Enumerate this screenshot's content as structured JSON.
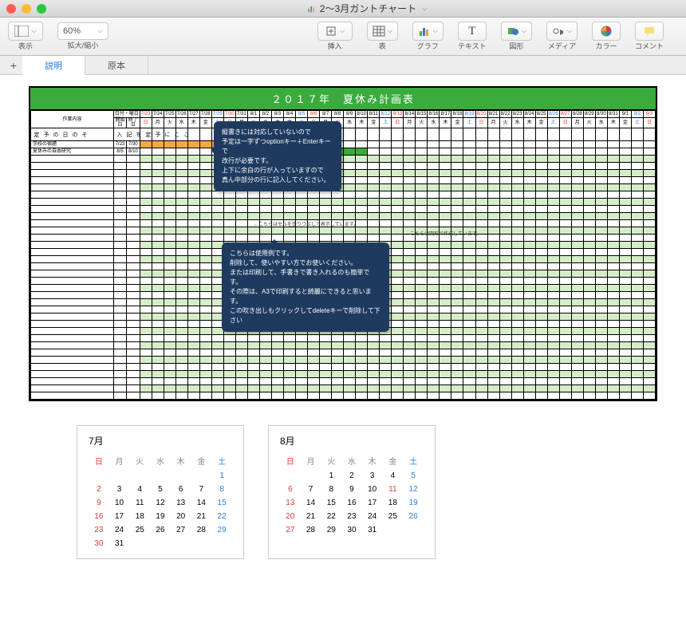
{
  "window": {
    "document_title": "2〜3月ガントチャート"
  },
  "toolbar": {
    "view_label": "表示",
    "zoom_value": "60%",
    "zoom_label": "拡大/縮小",
    "insert_label": "挿入",
    "table_label": "表",
    "chart_label": "グラフ",
    "text_label": "テキスト",
    "shape_label": "図形",
    "media_label": "メディア",
    "color_label": "カラー",
    "comment_label": "コメント"
  },
  "tabs": {
    "active": "説明",
    "other": "原本"
  },
  "sheet": {
    "title": "２０１７年　夏休み計画表",
    "header_work": "作業内容",
    "header_date": "日付・曜日",
    "header_start": "開始日",
    "header_end": "終了日",
    "schedule_label": "その日の予定",
    "schedule_hint": "ここに予定を記入",
    "dates": [
      "7/23",
      "7/24",
      "7/25",
      "7/26",
      "7/27",
      "7/28",
      "7/29",
      "7/30",
      "7/31",
      "8/1",
      "8/2",
      "8/3",
      "8/4",
      "8/5",
      "8/6",
      "8/7",
      "8/8",
      "8/9",
      "8/10",
      "8/11",
      "8/12",
      "8/13",
      "8/14",
      "8/15",
      "8/16",
      "8/17",
      "8/18",
      "8/19",
      "8/20",
      "8/21",
      "8/22",
      "8/23",
      "8/24",
      "8/25",
      "8/26",
      "8/27",
      "8/28",
      "8/29",
      "8/30",
      "8/31",
      "9/1",
      "9/2",
      "9/3"
    ],
    "dow": [
      "日",
      "月",
      "火",
      "水",
      "木",
      "金",
      "土",
      "日",
      "月",
      "火",
      "水",
      "木",
      "金",
      "土",
      "日",
      "月",
      "火",
      "水",
      "木",
      "金",
      "土",
      "日",
      "月",
      "火",
      "水",
      "木",
      "金",
      "土",
      "日",
      "月",
      "火",
      "水",
      "木",
      "金",
      "土",
      "日",
      "月",
      "火",
      "水",
      "木",
      "金",
      "土",
      "日"
    ],
    "rows": [
      {
        "label": "学校の宿題",
        "start": "7/23",
        "end": "7/30",
        "fill": {
          "type": "orange",
          "from": 0,
          "to": 7
        },
        "note": "←こちらはセルを塗りつぶしで表示しています。"
      },
      {
        "label": "夏休みの自由研究",
        "start": "8/5",
        "end": "8/10",
        "fill": {
          "type": "green",
          "from": 13,
          "to": 18
        },
        "note": "←こちらは図形で作成しています。"
      }
    ]
  },
  "callouts": {
    "c1": "縦書きには対応していないので\n予定は一字ずつoptionキー＋Enterキーで\n改行が必要です。\n上下に余白の行が入っていますので\n真ん中部分の行に記入してください。",
    "c2": "こちらは使用例です。\n削除して、使いやすい方でお使いください。\nまたは印刷して、手書きで書き入れるのも簡単です。\nその際は、A3で印刷すると綺麗にできると思います。\nこの吹き出しもクリックしてdeleteキーで削除して下さい"
  },
  "calendars": {
    "july": {
      "title": "7月",
      "dow": [
        "日",
        "月",
        "火",
        "水",
        "木",
        "金",
        "土"
      ],
      "weeks": [
        [
          "",
          "",
          "",
          "",
          "",
          "",
          "1"
        ],
        [
          "2",
          "3",
          "4",
          "5",
          "6",
          "7",
          "8"
        ],
        [
          "9",
          "10",
          "11",
          "12",
          "13",
          "14",
          "15"
        ],
        [
          "16",
          "17",
          "18",
          "19",
          "20",
          "21",
          "22"
        ],
        [
          "23",
          "24",
          "25",
          "26",
          "27",
          "28",
          "29"
        ],
        [
          "30",
          "31",
          "",
          "",
          "",
          "",
          ""
        ]
      ]
    },
    "august": {
      "title": "8月",
      "dow": [
        "日",
        "月",
        "火",
        "水",
        "木",
        "金",
        "土"
      ],
      "weeks": [
        [
          "",
          "",
          "1",
          "2",
          "3",
          "4",
          "5"
        ],
        [
          "6",
          "7",
          "8",
          "9",
          "10",
          "11",
          "12"
        ],
        [
          "13",
          "14",
          "15",
          "16",
          "17",
          "18",
          "19"
        ],
        [
          "20",
          "21",
          "22",
          "23",
          "24",
          "25",
          "26"
        ],
        [
          "27",
          "28",
          "29",
          "30",
          "31",
          "",
          ""
        ]
      ],
      "holiday": "11"
    }
  }
}
